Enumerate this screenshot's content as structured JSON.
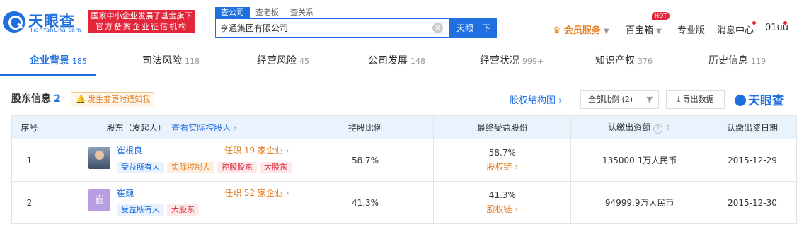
{
  "header": {
    "logo_cn": "天眼查",
    "logo_en": "TianYanCha.com",
    "tag_line1": "国家中小企业发展子基金旗下",
    "tag_line2": "官方备案企业征信机构",
    "search_tabs": [
      "查公司",
      "查老板",
      "查关系"
    ],
    "search_value": "亨通集团有限公司",
    "search_button": "天眼一下",
    "nav": {
      "vip": "会员服务",
      "baibao": "百宝箱",
      "hot": "HOT",
      "pro": "专业版",
      "msg": "消息中心",
      "user": "01uu"
    }
  },
  "tabs": [
    {
      "label": "企业背景",
      "count": "185"
    },
    {
      "label": "司法风险",
      "count": "118"
    },
    {
      "label": "经营风险",
      "count": "45"
    },
    {
      "label": "公司发展",
      "count": "148"
    },
    {
      "label": "经营状况",
      "count": "999+"
    },
    {
      "label": "知识产权",
      "count": "376"
    },
    {
      "label": "历史信息",
      "count": "119"
    }
  ],
  "section": {
    "title": "股东信息",
    "count": "2",
    "notify": "发生变更时通知我",
    "structure_link": "股权结构图",
    "ratio_select": "全部比例 (2)",
    "export": "导出数据",
    "brand": "天眼查"
  },
  "table": {
    "headers": {
      "idx": "序号",
      "holder": "股东（发起人）",
      "holder_link": "查看实际控股人",
      "ratio": "持股比例",
      "final": "最终受益股份",
      "capital": "认缴出资额",
      "date": "认缴出资日期"
    },
    "rows": [
      {
        "idx": "1",
        "name": "崔根良",
        "position": "任职 19 家企业",
        "tags": [
          "受益所有人",
          "实际控制人",
          "控股股东",
          "大股东"
        ],
        "ratio": "58.7%",
        "final": "58.7%",
        "chain": "股权链",
        "capital": "135000.1万人民币",
        "date": "2015-12-29"
      },
      {
        "idx": "2",
        "name": "崔巍",
        "avatar_char": "崔",
        "position": "任职 52 家企业",
        "tags": [
          "受益所有人",
          "大股东"
        ],
        "ratio": "41.3%",
        "final": "41.3%",
        "chain": "股权链",
        "capital": "94999.9万人民币",
        "date": "2015-12-30"
      }
    ]
  },
  "colors": {
    "brand": "#1f6fe0",
    "accent": "#e67e22",
    "red": "#e3263a"
  }
}
